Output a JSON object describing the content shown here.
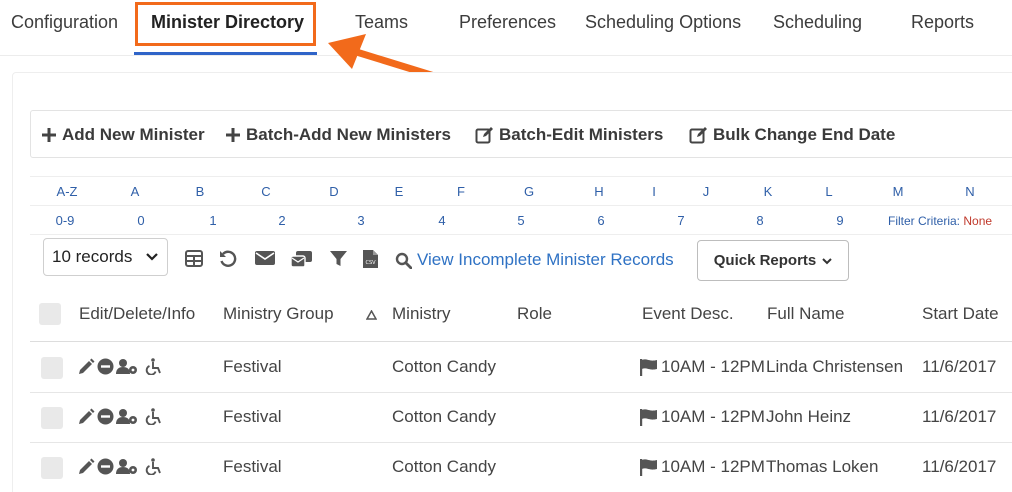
{
  "nav": {
    "tabs": [
      {
        "label": "Configuration"
      },
      {
        "label": "Minister Directory"
      },
      {
        "label": "Teams"
      },
      {
        "label": "Preferences"
      },
      {
        "label": "Scheduling Options"
      },
      {
        "label": "Scheduling"
      },
      {
        "label": "Reports"
      }
    ],
    "active_index": 1
  },
  "annotation": {
    "highlight_color": "#f26a1b"
  },
  "toolbar": {
    "add_new": "Add New Minister",
    "batch_add": "Batch-Add New Ministers",
    "batch_edit": "Batch-Edit Ministers",
    "bulk_change": "Bulk Change End Date"
  },
  "alpha_filter": {
    "row1": [
      "A-Z",
      "A",
      "B",
      "C",
      "D",
      "E",
      "F",
      "G",
      "H",
      "I",
      "J",
      "K",
      "L",
      "M",
      "N"
    ],
    "row2": [
      "0-9",
      "0",
      "1",
      "2",
      "3",
      "4",
      "5",
      "6",
      "7",
      "8",
      "9"
    ],
    "filter_label": "Filter Criteria:",
    "filter_value": "None"
  },
  "controls": {
    "records_selected": "10 records",
    "view_incomplete": "View Incomplete Minister Records",
    "quick_reports": "Quick Reports"
  },
  "table": {
    "headers": {
      "edit": "Edit/Delete/Info",
      "ministry_group": "Ministry Group",
      "ministry": "Ministry",
      "role": "Role",
      "event_desc": "Event Desc.",
      "full_name": "Full Name",
      "start_date": "Start Date"
    },
    "rows": [
      {
        "ministry_group": "Festival",
        "ministry": "Cotton Candy",
        "role": "",
        "event_desc": "10AM - 12PM",
        "full_name": "Linda Christensen",
        "start_date": "11/6/2017"
      },
      {
        "ministry_group": "Festival",
        "ministry": "Cotton Candy",
        "role": "",
        "event_desc": "10AM - 12PM",
        "full_name": "John Heinz",
        "start_date": "11/6/2017"
      },
      {
        "ministry_group": "Festival",
        "ministry": "Cotton Candy",
        "role": "",
        "event_desc": "10AM - 12PM",
        "full_name": "Thomas Loken",
        "start_date": "11/6/2017"
      }
    ]
  },
  "colors": {
    "link": "#2f5fa8",
    "accent": "#2f64c8",
    "filter_none": "#c0392b"
  }
}
